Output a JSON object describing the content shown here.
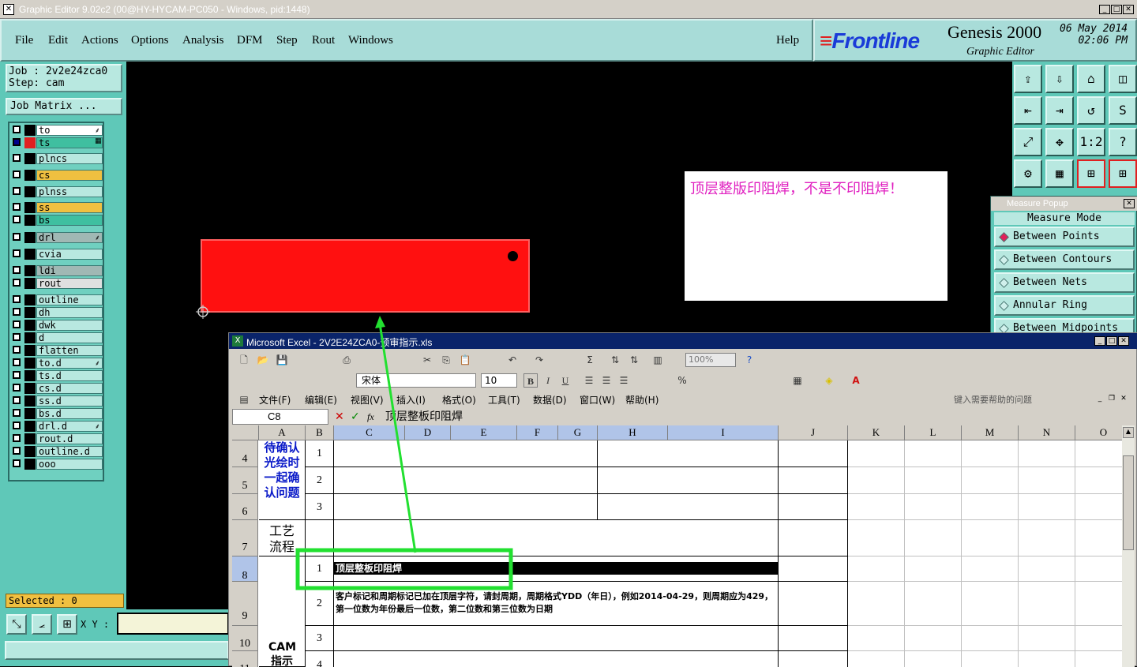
{
  "app": {
    "title": "Graphic Editor 9.02c2 (00@HY-HYCAM-PC050 - Windows, pid:1448)"
  },
  "menu": {
    "items": [
      "File",
      "Edit",
      "Actions",
      "Options",
      "Analysis",
      "DFM",
      "Step",
      "Rout",
      "Windows"
    ],
    "help": "Help"
  },
  "brand": {
    "logo": "Frontline",
    "product": "Genesis 2000",
    "sub": "Graphic Editor",
    "date": "06 May 2014",
    "time": "02:06 PM"
  },
  "job": {
    "job": "Job : 2v2e24zca0",
    "step": "Step: cam",
    "matrix": "Job Matrix ..."
  },
  "layers": [
    {
      "name": "to",
      "color": "#ffffff",
      "sw": "#000000",
      "checked": false,
      "mark": "⸙"
    },
    {
      "name": "ts",
      "color": "#3fbfa0",
      "sw": "#e02020",
      "checked": true,
      "mark": "▦"
    },
    {
      "name": "plncs",
      "color": "#b8e8e0",
      "sw": "#000000",
      "checked": false,
      "mark": ""
    },
    {
      "name": "cs",
      "color": "#f0c040",
      "sw": "#000000",
      "checked": false,
      "mark": ""
    },
    {
      "name": "plnss",
      "color": "#b8e8e0",
      "sw": "#000000",
      "checked": false,
      "mark": ""
    },
    {
      "name": "ss",
      "color": "#f0c040",
      "sw": "#000000",
      "checked": false,
      "mark": ""
    },
    {
      "name": "bs",
      "color": "#3fbfa0",
      "sw": "#000000",
      "checked": false,
      "mark": ""
    },
    {
      "name": "drl",
      "color": "#a0b8b4",
      "sw": "#000000",
      "checked": false,
      "mark": "⸙"
    },
    {
      "name": "cvia",
      "color": "#b8e8e0",
      "sw": "#000000",
      "checked": false,
      "mark": ""
    },
    {
      "name": "ldi",
      "color": "#a0b8b4",
      "sw": "#000000",
      "checked": false,
      "mark": ""
    },
    {
      "name": "rout",
      "color": "#e0e0e0",
      "sw": "#000000",
      "checked": false,
      "mark": ""
    },
    {
      "name": "outline",
      "color": "#b8e8e0",
      "sw": "#000000",
      "checked": false,
      "mark": ""
    },
    {
      "name": "dh",
      "color": "#b8e8e0",
      "sw": "#000000",
      "checked": false,
      "mark": ""
    },
    {
      "name": "dwk",
      "color": "#b8e8e0",
      "sw": "#000000",
      "checked": false,
      "mark": ""
    },
    {
      "name": "d",
      "color": "#b8e8e0",
      "sw": "#000000",
      "checked": false,
      "mark": ""
    },
    {
      "name": "flatten",
      "color": "#b8e8e0",
      "sw": "#000000",
      "checked": false,
      "mark": ""
    },
    {
      "name": "to.d",
      "color": "#b8e8e0",
      "sw": "#000000",
      "checked": false,
      "mark": "⸙"
    },
    {
      "name": "ts.d",
      "color": "#b8e8e0",
      "sw": "#000000",
      "checked": false,
      "mark": ""
    },
    {
      "name": "cs.d",
      "color": "#b8e8e0",
      "sw": "#000000",
      "checked": false,
      "mark": ""
    },
    {
      "name": "ss.d",
      "color": "#b8e8e0",
      "sw": "#000000",
      "checked": false,
      "mark": ""
    },
    {
      "name": "bs.d",
      "color": "#b8e8e0",
      "sw": "#000000",
      "checked": false,
      "mark": ""
    },
    {
      "name": "drl.d",
      "color": "#b8e8e0",
      "sw": "#000000",
      "checked": false,
      "mark": "⸙"
    },
    {
      "name": "rout.d",
      "color": "#b8e8e0",
      "sw": "#000000",
      "checked": false,
      "mark": ""
    },
    {
      "name": "outline.d",
      "color": "#b8e8e0",
      "sw": "#000000",
      "checked": false,
      "mark": ""
    },
    {
      "name": "ooo",
      "color": "#b8e8e0",
      "sw": "#000000",
      "checked": false,
      "mark": ""
    }
  ],
  "status": {
    "selected": "Selected : 0",
    "xy_label": "X Y :",
    "xy_value": ""
  },
  "canvas": {
    "note": "顶层整版印阻焊，不是不印阻焊！"
  },
  "tools": [
    "⇪",
    "⇩",
    "⌂",
    "◫",
    "⇤",
    "⇥",
    "↺",
    "S",
    "⤢",
    "✥",
    "1:2",
    "?",
    "⚙",
    "▦",
    "⊞",
    "⊞"
  ],
  "measure": {
    "title": "Measure Popup",
    "head": "Measure Mode",
    "options": [
      "Between Points",
      "Between Contours",
      "Between Nets",
      "Annular Ring",
      "Between Midpoints"
    ],
    "selected": 0
  },
  "excel": {
    "title": "Microsoft Excel - 2V2E24ZCA0-预审指示.xls",
    "font": "宋体",
    "size": "10",
    "zoom": "100%",
    "menus": [
      "文件(F)",
      "编辑(E)",
      "视图(V)",
      "插入(I)",
      "格式(O)",
      "工具(T)",
      "数据(D)",
      "窗口(W)",
      "帮助(H)"
    ],
    "help_placeholder": "键入需要帮助的问题",
    "namebox": "C8",
    "formula": "顶层整板印阻焊",
    "cols": [
      "A",
      "B",
      "C",
      "D",
      "E",
      "F",
      "G",
      "H",
      "I",
      "J",
      "K",
      "L",
      "M",
      "N",
      "O"
    ],
    "rows": [
      "4",
      "5",
      "6",
      "7",
      "8",
      "9",
      "10",
      "11"
    ],
    "a_confirm": "待确认光绘时一起确认问题",
    "a_process": "工艺流程指示",
    "a_cam": "CAM指示",
    "b_vals": [
      "1",
      "2",
      "3",
      "1",
      "2",
      "3",
      "4"
    ],
    "c8": "顶层整板印阻焊",
    "c9": "客户标记和周期标记已加在顶层字符，请封周期，周期格式YDD（年日），例如2014-04-29，则周期应为429，第一位数为年份最后一位数，第二位数和第三位数为日期"
  }
}
